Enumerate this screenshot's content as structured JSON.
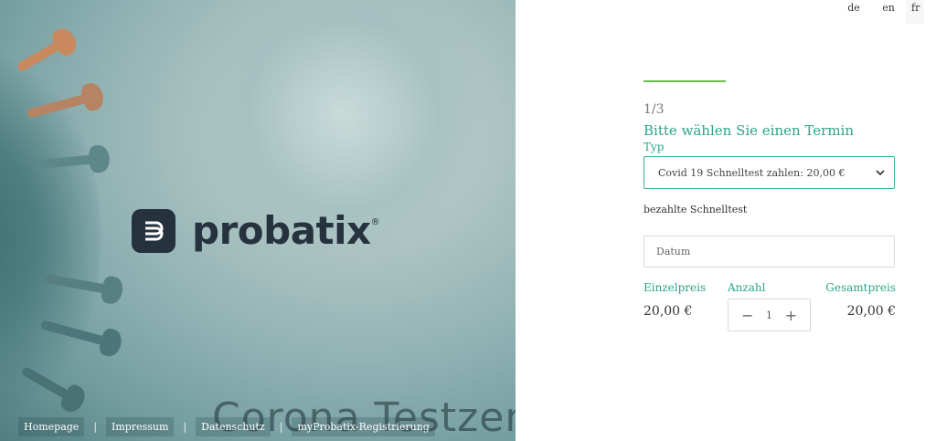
{
  "hero": {
    "brand": "probatix",
    "registered": "®",
    "banner_text": "Corona Testzen"
  },
  "footer": {
    "links": [
      "Homepage",
      "Impressum",
      "Datenschutz",
      "myProbatix-Registrierung"
    ],
    "separator": "|"
  },
  "lang": {
    "items": [
      "de",
      "en",
      "fr"
    ],
    "active": "en"
  },
  "booking": {
    "step": "1/3",
    "title": "Bitte wählen Sie einen Termin",
    "type_label": "Typ",
    "type_selected": "Covid 19 Schnelltest zahlen: 20,00 €",
    "note": "bezahlte Schnelltest",
    "date_placeholder": "Datum",
    "headers": {
      "unit": "Einzelpreis",
      "qty": "Anzahl",
      "total": "Gesamtpreis"
    },
    "unit_price": "20,00 €",
    "quantity": "1",
    "total_price": "20,00 €"
  },
  "colors": {
    "accent": "#2ba488",
    "progress": "#6abf4b",
    "logo_dark": "#27323f"
  }
}
